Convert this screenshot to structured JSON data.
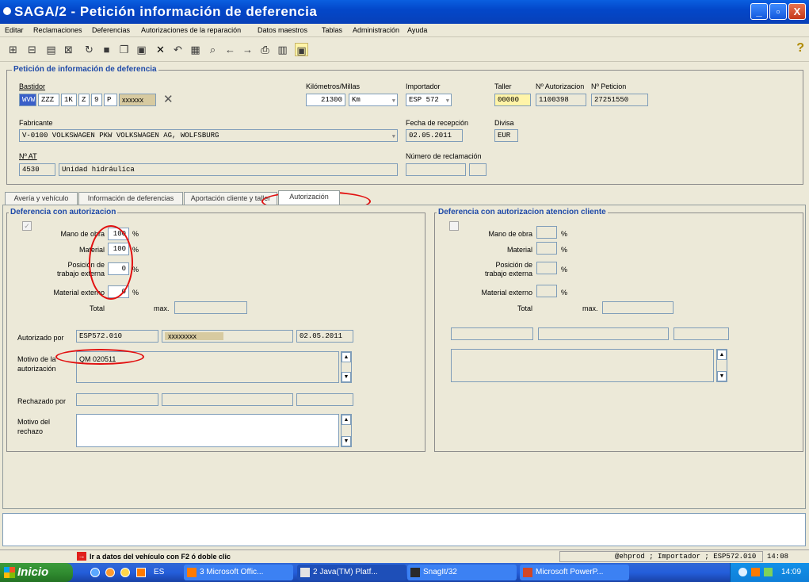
{
  "window": {
    "title": "SAGA/2 - Petición información de deferencia",
    "minimize": "_",
    "maximize": "▫",
    "close": "X"
  },
  "menu": [
    "Editar",
    "Reclamaciones",
    "Deferencias",
    "Autorizaciones de la reparación",
    "Datos maestros",
    "Tablas",
    "Administración",
    "Ayuda"
  ],
  "toolbar": {
    "help": "?"
  },
  "header": {
    "legend": "Petición de información de deferencia",
    "bastidor_label": "Bastidor",
    "bastidor": [
      "WVW",
      "ZZZ",
      "1K",
      "Z",
      "9",
      "P",
      "xxxxxx"
    ],
    "clear_icon": "✕",
    "km_label": "Kilómetros/Millas",
    "km_value": "21300",
    "km_unit": "Km",
    "importador_label": "Importador",
    "importador_value": "ESP 572",
    "taller_label": "Taller",
    "taller_value": "00000",
    "autorizacion_label": "Nº Autorizacion",
    "autorizacion_value": "1100398",
    "peticion_label": "Nº Peticion",
    "peticion_value": "27251550",
    "fabricante_label": "Fabricante",
    "fabricante_value": "V-0100 VOLKSWAGEN PKW VOLKSWAGEN AG, WOLFSBURG",
    "fecha_label": "Fecha de recepción",
    "fecha_value": "02.05.2011",
    "divisa_label": "Divisa",
    "divisa_value": "EUR",
    "at_label": "Nº AT",
    "at_code": "4530",
    "at_desc": "Unidad hidráulica",
    "reclamacion_label": "Número de reclamación"
  },
  "tabs": [
    "Avería y vehículo",
    "Información de deferencias",
    "Aportación cliente y taller",
    "Autorización"
  ],
  "left": {
    "legend": "Deferencia con autorizacion",
    "check_mark": "✓",
    "mano_label": "Mano de obra",
    "mano_value": "100",
    "material_label": "Material",
    "material_value": "100",
    "posicion_label_1": "Posición de",
    "posicion_label_2": "trabajo externa",
    "posicion_value": "0",
    "material_ext_label": "Material externo",
    "material_ext_value": "0",
    "pct": "%",
    "total_label": "Total",
    "max_label": "max.",
    "autorizado_label": "Autorizado por",
    "autorizado_value": "ESP572.010",
    "autorizado_name": "xxxxxxxx",
    "autorizado_date": "02.05.2011",
    "motivo_label_1": "Motivo de la",
    "motivo_label_2": "autorización",
    "motivo_value": "QM 020511",
    "rechazado_label": "Rechazado por",
    "motivo_rechazo_1": "Motivo del",
    "motivo_rechazo_2": "rechazo"
  },
  "right": {
    "legend": "Deferencia con autorizacion atencion cliente",
    "mano_label": "Mano de obra",
    "material_label": "Material",
    "posicion_label_1": "Posición de",
    "posicion_label_2": "trabajo externa",
    "material_ext_label": "Material externo",
    "pct": "%",
    "total_label": "Total",
    "max_label": "max."
  },
  "status": {
    "hint": "Ir a datos del vehículo con F2 ó doble clic",
    "session": "@ehprod ; Importador ; ESP572.010",
    "time": "14:08"
  },
  "taskbar": {
    "start": "Inicio",
    "lang": "ES",
    "tasks": [
      "3 Microsoft Offic...",
      "2 Java(TM) Platf...",
      "SnagIt/32",
      "Microsoft PowerP..."
    ],
    "clock": "14:09"
  }
}
